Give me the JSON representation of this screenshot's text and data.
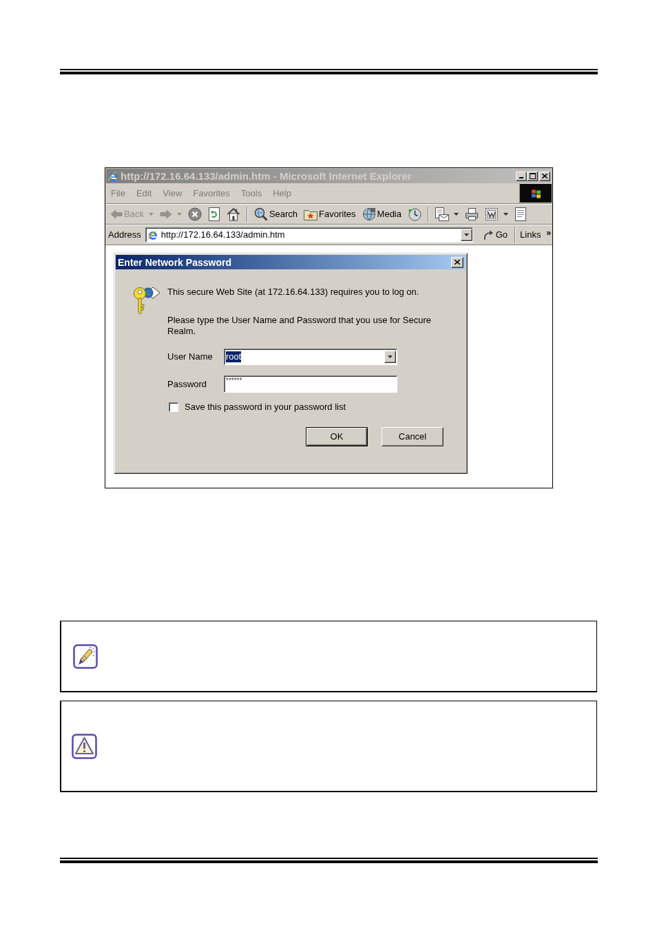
{
  "browser": {
    "title": "http://172.16.64.133/admin.htm - Microsoft Internet Explorer",
    "active": false,
    "menu": [
      "File",
      "Edit",
      "View",
      "Favorites",
      "Tools",
      "Help"
    ],
    "toolbar": [
      {
        "kind": "back",
        "label": "Back",
        "disabled": true,
        "dropdown": true
      },
      {
        "kind": "forward",
        "disabled": true,
        "dropdown": true
      },
      {
        "kind": "stop",
        "disabled": false,
        "dropdown": false
      },
      {
        "kind": "refresh",
        "disabled": false,
        "dropdown": false
      },
      {
        "kind": "home",
        "disabled": false,
        "dropdown": false
      },
      {
        "kind": "separator"
      },
      {
        "kind": "search",
        "label": "Search",
        "disabled": false,
        "dropdown": false
      },
      {
        "kind": "favorites",
        "label": "Favorites",
        "disabled": false,
        "dropdown": false
      },
      {
        "kind": "media",
        "label": "Media",
        "disabled": false,
        "dropdown": false
      },
      {
        "kind": "history",
        "disabled": false,
        "dropdown": false
      },
      {
        "kind": "separator"
      },
      {
        "kind": "mail",
        "disabled": false,
        "dropdown": true
      },
      {
        "kind": "print",
        "disabled": false,
        "dropdown": false
      },
      {
        "kind": "edit",
        "disabled": false,
        "dropdown": true
      },
      {
        "kind": "discuss",
        "disabled": false,
        "dropdown": false
      }
    ],
    "address": {
      "label": "Address",
      "value": "http://172.16.64.133/admin.htm",
      "go": "Go",
      "links": "Links",
      "more": "»"
    }
  },
  "dialog": {
    "title": "Enter Network Password",
    "active": true,
    "message": "This secure Web Site (at 172.16.64.133) requires you to log on.",
    "prompt": "Please type the User Name and Password that you use for Secure Realm.",
    "fields": [
      {
        "kind": "combo",
        "label": "User Name",
        "value": "root",
        "highlighted": true
      },
      {
        "kind": "password",
        "label": "Password",
        "value": "******",
        "highlighted": false
      }
    ],
    "save_password": {
      "label": "Save this password in your password list",
      "checked": false
    },
    "buttons": [
      {
        "label": "OK",
        "default": true
      },
      {
        "label": "Cancel",
        "default": false
      }
    ]
  },
  "notes": [
    {
      "kind": "note"
    },
    {
      "kind": "warning"
    }
  ]
}
